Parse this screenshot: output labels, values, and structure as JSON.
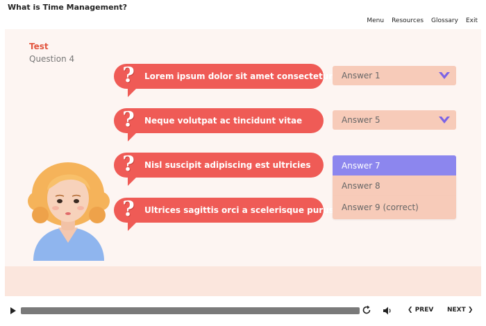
{
  "window": {
    "title": "What is Time Management?"
  },
  "topnav": {
    "menu": "Menu",
    "resources": "Resources",
    "glossary": "Glossary",
    "exit": "Exit"
  },
  "slide": {
    "section_label": "Test",
    "question_label": "Question 4",
    "questions": [
      {
        "text": "Lorem ipsum dolor sit amet consectetur",
        "answer": "Answer 1"
      },
      {
        "text": "Neque volutpat ac tincidunt vitae",
        "answer": "Answer 5"
      },
      {
        "text": "Nisl suscipit adipiscing est ultricies"
      },
      {
        "text": "Ultrices sagittis orci a scelerisque purus"
      }
    ],
    "qmark": "?",
    "open_dropdown_options": [
      "Answer 7",
      "Answer 8",
      "Answer 9 (correct)"
    ]
  },
  "player": {
    "prev_label": "PREV",
    "next_label": "NEXT"
  },
  "colors": {
    "accent": "#ef5b56",
    "selected_option": "#8c86ee",
    "dropdown": "#f7cbb9",
    "chevron": "#7b63e6"
  }
}
